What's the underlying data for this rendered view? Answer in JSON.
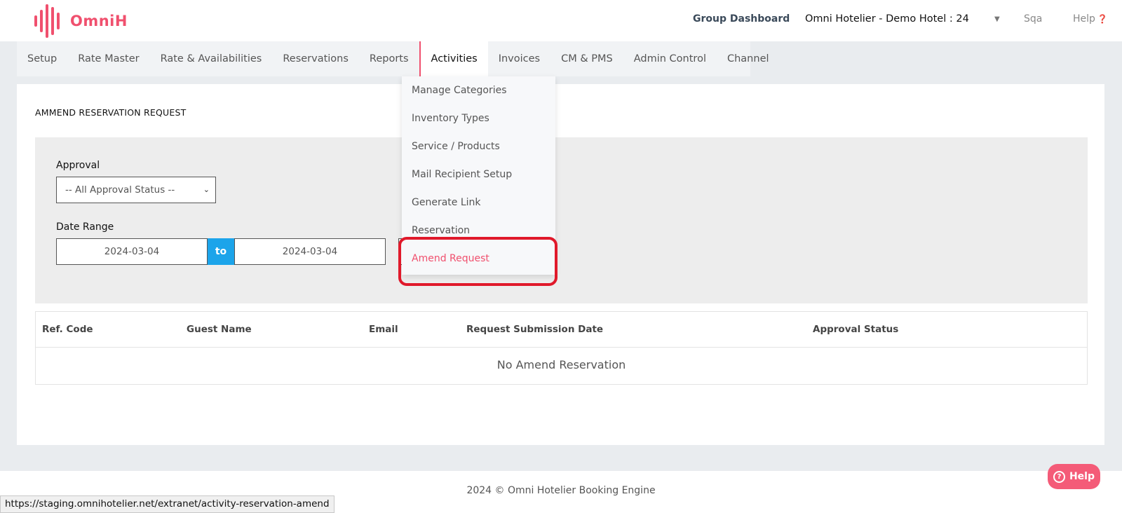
{
  "brand": {
    "name": "OmniH",
    "color": "#f0506e"
  },
  "header": {
    "group_dashboard": "Group Dashboard",
    "hotel": "Omni Hotelier - Demo Hotel : 24",
    "user": "Sqa",
    "help": "Help"
  },
  "nav": {
    "items": [
      "Setup",
      "Rate Master",
      "Rate & Availabilities",
      "Reservations",
      "Reports",
      "Activities",
      "Invoices",
      "CM & PMS",
      "Admin Control",
      "Channel"
    ],
    "active": "Activities"
  },
  "dropdown": {
    "items": [
      "Manage Categories",
      "Inventory Types",
      "Service / Products",
      "Mail Recipient Setup",
      "Generate Link",
      "Reservation",
      "Amend Request"
    ],
    "active": "Amend Request"
  },
  "page": {
    "title": "AMMEND RESERVATION REQUEST",
    "approval_label": "Approval",
    "approval_value": "-- All Approval Status --",
    "date_label": "Date Range",
    "date_from": "2024-03-04",
    "to_label": "to",
    "date_to": "2024-03-04"
  },
  "table": {
    "columns": [
      "Ref. Code",
      "Guest Name",
      "Email",
      "Request Submission Date",
      "Approval Status"
    ],
    "empty_message": "No Amend Reservation"
  },
  "footer": {
    "copyright": "2024 © Omni Hotelier Booking Engine",
    "status_url": "https://staging.omnihotelier.net/extranet/activity-reservation-amend",
    "help_button": "Help"
  },
  "colors": {
    "accent": "#f0506e",
    "to_chip": "#1ca4ea",
    "highlight": "#e0192b"
  }
}
